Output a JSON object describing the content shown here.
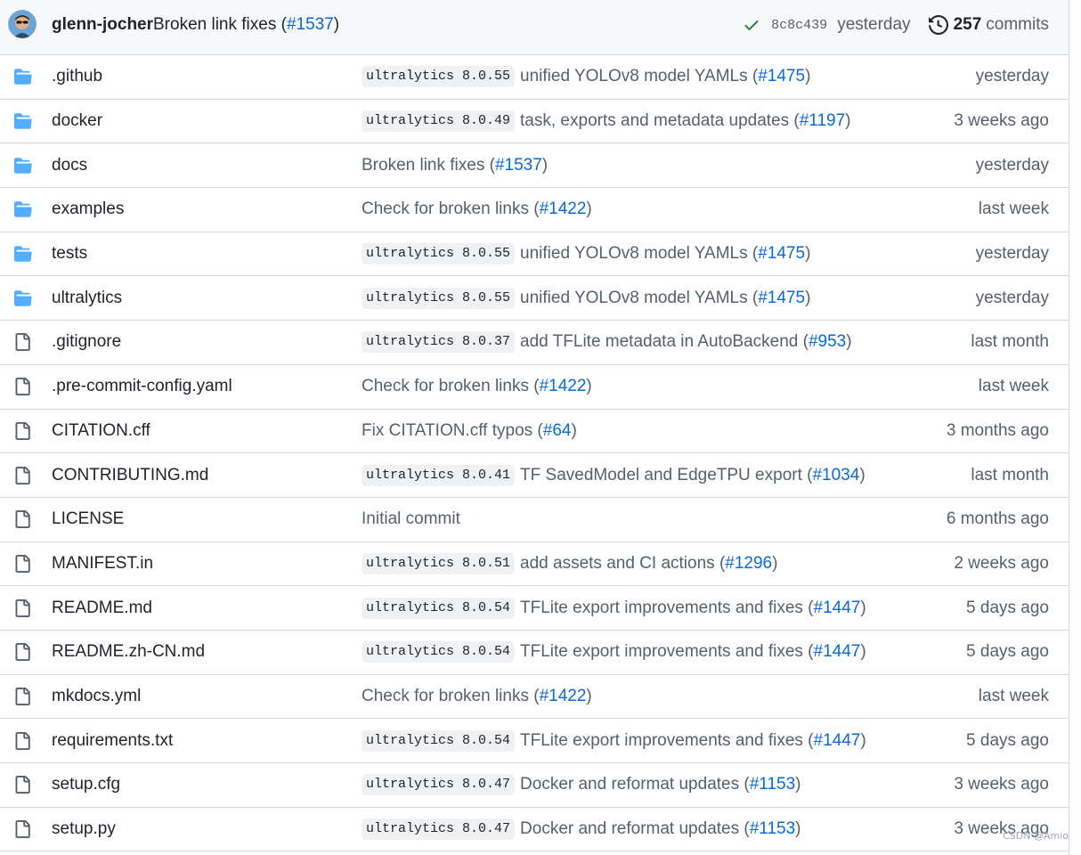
{
  "latest_commit": {
    "author": "glenn-jocher",
    "message": "Broken link fixes",
    "pr": "#1537",
    "sha": "8c8c439",
    "time": "yesterday",
    "commits_count": "257",
    "commits_label": "commits"
  },
  "files": [
    {
      "type": "folder",
      "name": ".github",
      "tag": "ultralytics 8.0.55",
      "message": "unified YOLOv8 model YAMLs",
      "pr": "#1475",
      "time": "yesterday"
    },
    {
      "type": "folder",
      "name": "docker",
      "tag": "ultralytics 8.0.49",
      "message": "task, exports and metadata updates",
      "pr": "#1197",
      "time": "3 weeks ago"
    },
    {
      "type": "folder",
      "name": "docs",
      "tag": "",
      "message": "Broken link fixes",
      "pr": "#1537",
      "time": "yesterday"
    },
    {
      "type": "folder",
      "name": "examples",
      "tag": "",
      "message": "Check for broken links",
      "pr": "#1422",
      "time": "last week"
    },
    {
      "type": "folder",
      "name": "tests",
      "tag": "ultralytics 8.0.55",
      "message": "unified YOLOv8 model YAMLs",
      "pr": "#1475",
      "time": "yesterday"
    },
    {
      "type": "folder",
      "name": "ultralytics",
      "tag": "ultralytics 8.0.55",
      "message": "unified YOLOv8 model YAMLs",
      "pr": "#1475",
      "time": "yesterday"
    },
    {
      "type": "file",
      "name": ".gitignore",
      "tag": "ultralytics 8.0.37",
      "message": "add TFLite metadata in AutoBackend",
      "pr": "#953",
      "time": "last month"
    },
    {
      "type": "file",
      "name": ".pre-commit-config.yaml",
      "tag": "",
      "message": "Check for broken links",
      "pr": "#1422",
      "time": "last week"
    },
    {
      "type": "file",
      "name": "CITATION.cff",
      "tag": "",
      "message": "Fix CITATION.cff typos",
      "pr": "#64",
      "time": "3 months ago"
    },
    {
      "type": "file",
      "name": "CONTRIBUTING.md",
      "tag": "ultralytics 8.0.41",
      "message": "TF SavedModel and EdgeTPU export",
      "pr": "#1034",
      "time": "last month"
    },
    {
      "type": "file",
      "name": "LICENSE",
      "tag": "",
      "message": "Initial commit",
      "pr": "",
      "time": "6 months ago"
    },
    {
      "type": "file",
      "name": "MANIFEST.in",
      "tag": "ultralytics 8.0.51",
      "message": "add assets and CI actions",
      "pr": "#1296",
      "time": "2 weeks ago"
    },
    {
      "type": "file",
      "name": "README.md",
      "tag": "ultralytics 8.0.54",
      "message": "TFLite export improvements and fixes",
      "pr": "#1447",
      "time": "5 days ago"
    },
    {
      "type": "file",
      "name": "README.zh-CN.md",
      "tag": "ultralytics 8.0.54",
      "message": "TFLite export improvements and fixes",
      "pr": "#1447",
      "time": "5 days ago"
    },
    {
      "type": "file",
      "name": "mkdocs.yml",
      "tag": "",
      "message": "Check for broken links",
      "pr": "#1422",
      "time": "last week"
    },
    {
      "type": "file",
      "name": "requirements.txt",
      "tag": "ultralytics 8.0.54",
      "message": "TFLite export improvements and fixes",
      "pr": "#1447",
      "time": "5 days ago"
    },
    {
      "type": "file",
      "name": "setup.cfg",
      "tag": "ultralytics 8.0.47",
      "message": "Docker and reformat updates",
      "pr": "#1153",
      "time": "3 weeks ago"
    },
    {
      "type": "file",
      "name": "setup.py",
      "tag": "ultralytics 8.0.47",
      "message": "Docker and reformat updates",
      "pr": "#1153",
      "time": "3 weeks ago"
    }
  ],
  "icons": {
    "folder": "folder-icon",
    "file": "file-icon",
    "check": "check-icon",
    "history": "history-icon"
  },
  "colors": {
    "folder": "#54aeff",
    "link": "#0969da",
    "check": "#1a7f37",
    "muted": "#57606a"
  },
  "watermark": "CSDN @Amio"
}
